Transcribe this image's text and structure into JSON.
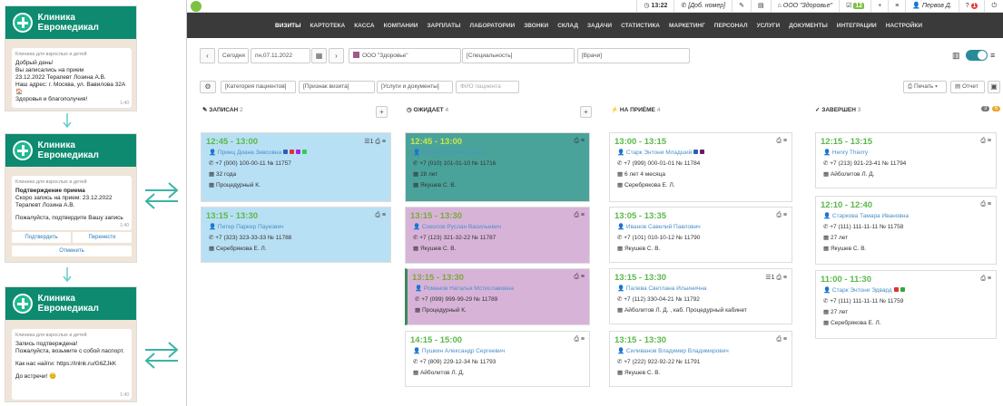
{
  "phones": [
    {
      "title": "Клиника Евромедикал",
      "sub": "Клиника для взрослых и детей",
      "lines": [
        "Добрый день!",
        "Вы записались на прием",
        "23.12.2022 Терапевт Лозина А.В.",
        "Наш адрес: г. Москва, ул. Вавилова 32А 🏠",
        "Здоровья и благополучия!"
      ],
      "time": "1:40"
    },
    {
      "title": "Клиника Евромедикал",
      "sub": "Клиника для взрослых и детей",
      "lines": [
        "Подтверждение приема",
        "Скоро запись на прием: 23.12.2022",
        "Терапевт Лозина А.В.",
        "",
        "Пожалуйста, подтвердите Вашу запись"
      ],
      "time": "1:40",
      "buttons": [
        "Подтвердить",
        "Перенести",
        "Отменить"
      ]
    },
    {
      "title": "Клиника Евромедикал",
      "sub": "Клиника для взрослых и детей",
      "lines": [
        "Запись подтверждена!",
        "Пожалуйста, возьмите с собой паспорт.",
        "",
        "Как нас найти: https://inlnk.ru/G6ZJkK",
        "",
        "До встречи! 😊"
      ],
      "time": "1:40"
    }
  ],
  "topbar": {
    "time": "13:22",
    "phone": "[Доб. номер]",
    "org": "ООО \"Здоровье\"",
    "badge1": "12",
    "user": "Первов Д.",
    "badge2": "1"
  },
  "nav": [
    "ВИЗИТЫ",
    "КАРТОТЕКА",
    "КАССА",
    "КОМПАНИИ",
    "ЗАРПЛАТЫ",
    "ЛАБОРАТОРИИ",
    "ЗВОНКИ",
    "СКЛАД",
    "ЗАДАЧИ",
    "СТАТИСТИКА",
    "МАРКЕТИНГ",
    "ПЕРСОНАЛ",
    "УСЛУГИ",
    "ДОКУМЕНТЫ",
    "ИНТЕГРАЦИИ",
    "НАСТРОЙКИ"
  ],
  "filters": {
    "today": "Сегодня",
    "date": "пн,07.11.2022",
    "org": "ООО \"Здоровье\"",
    "spec": "[Специальность]",
    "doctors": "[Врачи]",
    "cat": "[Категория пациентов]",
    "sign": "[Признак визита]",
    "services": "[Услуги и документы]",
    "fio": "ФИО пациента",
    "print": "Печать",
    "report": "Отчет"
  },
  "columns": [
    {
      "label": "ЗАПИСАН",
      "count": "2"
    },
    {
      "label": "ОЖИДАЕТ",
      "count": "4"
    },
    {
      "label": "НА ПРИЁМЕ",
      "count": "4"
    },
    {
      "label": "ЗАВЕРШЕН",
      "count": "3"
    }
  ],
  "badges": [
    "3",
    "6"
  ],
  "cards": {
    "c1": {
      "time": "12:45 - 13:00",
      "name": "Принц Диана Зевсовна",
      "phone": "+7 (000) 100-00-11",
      "num": "№ 11757",
      "extra": "32 года",
      "room": "Процедурный К."
    },
    "c2": {
      "time": "13:15 - 13:30",
      "name": "Питер Паркер Паукович",
      "phone": "+7 (323) 323-33-33",
      "num": "№ 11788",
      "room": "Серебрякова Е. Л."
    },
    "c3": {
      "time": "12:45 - 13:00",
      "name": "Ридекер Стивен Грант",
      "phone": "+7 (010) 101-01-10",
      "num": "№ 11716",
      "extra": "28 лет",
      "room": "Якушев С. В."
    },
    "c4": {
      "time": "13:15 - 13:30",
      "name": "Соколов Руслан Васильевич",
      "phone": "+7 (123) 321-32-22",
      "num": "№ 11787",
      "room": "Якушев С. В."
    },
    "c5": {
      "time": "13:15 - 13:30",
      "name": "Романов Наталья Мстиславовна",
      "phone": "+7 (099) 999-99-29",
      "num": "№ 11789",
      "room": "Процедурный К."
    },
    "c6": {
      "time": "14:15 - 15:00",
      "name": "Пушкин Александр Сергеевич",
      "phone": "+7 (809) 229-12-34",
      "num": "№ 11793",
      "room": "Айболитов Л. Д."
    },
    "c7": {
      "time": "13:00 - 13:15",
      "name": "Старк Энтони Младший",
      "phone": "+7 (999) 000-01-01",
      "num": "№ 11784",
      "extra": "6 лет 4 месяца",
      "room": "Серебрякова Е. Л."
    },
    "c8": {
      "time": "13:05 - 13:35",
      "name": "Иванов Савелий Павлович",
      "phone": "+7 (101) 010-10-12",
      "num": "№ 11790",
      "room": "Якушев С. В."
    },
    "c9": {
      "time": "13:15 - 13:30",
      "name": "Палева Светлана Ильинична",
      "phone": "+7 (112) 330-04-21",
      "num": "№ 11792",
      "room": "Айболитов Л. Д. , каб. Процедурный кабинет"
    },
    "c10": {
      "time": "13:15 - 13:30",
      "name": "Силиванов Владимир Владимирович",
      "phone": "+7 (222) 922-92-22",
      "num": "№ 11791",
      "room": "Якушев С. В."
    },
    "c11": {
      "time": "12:15 - 13:15",
      "name": "Henry Thierry",
      "phone": "+7 (213) 921-23-41",
      "num": "№ 11794",
      "room": "Айболитов Л. Д."
    },
    "c12": {
      "time": "12:10 - 12:40",
      "name": "Старкова Тамара Ивановна",
      "phone": "+7 (111) 111-11-11",
      "num": "№ 11758",
      "extra": "27 лет",
      "room": "Якушев С. В."
    },
    "c13": {
      "time": "11:00 - 11:30",
      "name": "Старк Энтони Эдвард",
      "phone": "+7 (111) 111-11-11",
      "num": "№ 11759",
      "extra": "27 лет",
      "room": "Серебрякова Е. Л."
    }
  }
}
